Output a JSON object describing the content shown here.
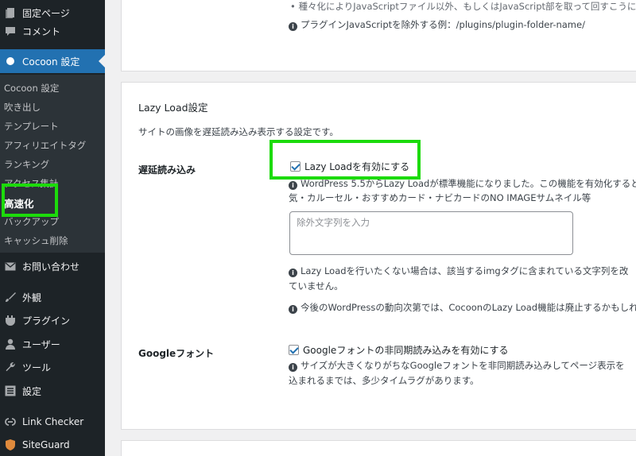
{
  "sidebar": {
    "top_items": [
      {
        "label": "固定ページ",
        "icon": "page-icon"
      },
      {
        "label": "コメント",
        "icon": "comment-icon"
      }
    ],
    "active_item": {
      "label": "Cocoon 設定",
      "icon": "cocoon-icon"
    },
    "submenu": [
      "Cocoon 設定",
      "吹き出し",
      "テンプレート",
      "アフィリエイトタグ",
      "ランキング",
      "アクセス集計",
      "高速化",
      "バックアップ",
      "キャッシュ削除"
    ],
    "bottom_items": [
      {
        "label": "お問い合わせ",
        "icon": "mail-icon"
      },
      {
        "label": "外観",
        "icon": "brush-icon"
      },
      {
        "label": "プラグイン",
        "icon": "plugin-icon"
      },
      {
        "label": "ユーザー",
        "icon": "user-icon"
      },
      {
        "label": "ツール",
        "icon": "wrench-icon"
      },
      {
        "label": "設定",
        "icon": "settings-icon"
      },
      {
        "label": "Link Checker",
        "icon": "link-icon"
      },
      {
        "label": "SiteGuard",
        "icon": "shield-icon"
      }
    ]
  },
  "top_card": {
    "partial_line": "• 種々化によりJavaScriptファイル以外、もしくはJavaScript部を取って回すこうに",
    "example_line": "プラグインJavaScriptを除外する例：/plugins/plugin-folder-name/"
  },
  "lazy_section": {
    "title": "Lazy Load設定",
    "description": "サイトの画像を遅延読み込み表示する設定です。",
    "lazy_label": "遅延読み込み",
    "lazy_checkbox": "Lazy Loadを有効にする",
    "lazy_note_1": "WordPress 5.5からLazy Loadが標準機能になりました。この機能を有効化すると",
    "lazy_note_2": "気・カルーセル・おすすめカード・ナビカードのNO IMAGEサムネイル等",
    "exclude_placeholder": "除外文字列を入力",
    "exclude_note_1": "Lazy Loadを行いたくない場合は、該当するimgタグに含まれている文字列を改",
    "exclude_note_2": "ていません。",
    "future_note": "今後のWordPressの動向次第では、CocoonのLazy Load機能は廃止するかもしれ",
    "google_label": "Googleフォント",
    "google_checkbox": "Googleフォントの非同期読み込みを有効にする",
    "google_note_1": "サイズが大きくなりがちなGoogleフォントを非同期読み込みしてページ表示を",
    "google_note_2": "込まれるまでは、多少タイムラグがあります。"
  },
  "colors": {
    "highlight": "#1cdb0b",
    "accent": "#2271b1",
    "sidebar": "#1d2327"
  }
}
